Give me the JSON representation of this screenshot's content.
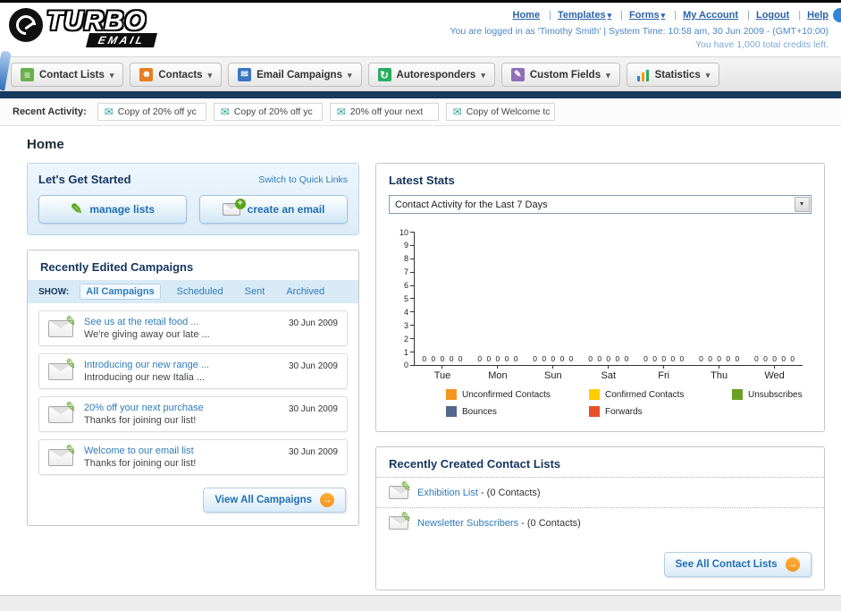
{
  "header": {
    "logo": {
      "title": "TURBO",
      "subtitle": "EMAIL"
    },
    "links": [
      {
        "label": "Home",
        "menu": false
      },
      {
        "label": "Templates",
        "menu": true
      },
      {
        "label": "Forms",
        "menu": true
      },
      {
        "label": "My Account",
        "menu": false
      },
      {
        "label": "Logout",
        "menu": false
      },
      {
        "label": "Help",
        "menu": false
      }
    ],
    "login_info": "You are logged in as 'Timothy Smith' | System Time: 10:58 am, 30 Jun 2009 - (GMT+10:00)",
    "credits_info": "You have 1,000 total credits left."
  },
  "nav": {
    "items": [
      {
        "label": "Contact Lists"
      },
      {
        "label": "Contacts"
      },
      {
        "label": "Email Campaigns"
      },
      {
        "label": "Autoresponders"
      },
      {
        "label": "Custom Fields"
      },
      {
        "label": "Statistics"
      }
    ]
  },
  "recent_activity": {
    "label": "Recent Activity:",
    "items": [
      "Copy of 20% off yc",
      "Copy of 20% off yc",
      "20% off your next",
      "Copy of Welcome tc"
    ]
  },
  "page_title": "Home",
  "get_started": {
    "title": "Let's Get Started",
    "switch_link": "Switch to Quick Links",
    "buttons": [
      {
        "label": "manage lists"
      },
      {
        "label": "create an email"
      }
    ]
  },
  "campaigns": {
    "title": "Recently Edited Campaigns",
    "show_label": "SHOW:",
    "tabs": [
      "All Campaigns",
      "Scheduled",
      "Sent",
      "Archived"
    ],
    "items": [
      {
        "title": "See us at the retail food ...",
        "subtitle": "We're giving away our late ...",
        "date": "30 Jun 2009"
      },
      {
        "title": "Introducing our new range ...",
        "subtitle": "Introducing our new Italia ...",
        "date": "30 Jun 2009"
      },
      {
        "title": "20% off your next purchase",
        "subtitle": "Thanks for joining our list!",
        "date": "30 Jun 2009"
      },
      {
        "title": "Welcome to our email list",
        "subtitle": "Thanks for joining our list!",
        "date": "30 Jun 2009"
      }
    ],
    "view_all_label": "View All Campaigns"
  },
  "latest_stats": {
    "title": "Latest Stats",
    "dropdown_value": "Contact Activity for the Last 7 Days",
    "chart_data": {
      "type": "bar",
      "title": "Contact Activity for the Last 7 Days",
      "categories": [
        "Tue",
        "Mon",
        "Sun",
        "Sat",
        "Fri",
        "Thu",
        "Wed"
      ],
      "series": [
        {
          "name": "Unconfirmed Contacts",
          "color": "#f7941d",
          "values": [
            0,
            0,
            0,
            0,
            0,
            0,
            0
          ]
        },
        {
          "name": "Confirmed Contacts",
          "color": "#ffcc00",
          "values": [
            0,
            0,
            0,
            0,
            0,
            0,
            0
          ]
        },
        {
          "name": "Unsubscribes",
          "color": "#6aa121",
          "values": [
            0,
            0,
            0,
            0,
            0,
            0,
            0
          ]
        },
        {
          "name": "Bounces",
          "color": "#51678f",
          "values": [
            0,
            0,
            0,
            0,
            0,
            0,
            0
          ]
        },
        {
          "name": "Forwards",
          "color": "#e8502a",
          "values": [
            0,
            0,
            0,
            0,
            0,
            0,
            0
          ]
        }
      ],
      "ylim": [
        0,
        10
      ],
      "xlabel": "",
      "ylabel": "",
      "grid": false,
      "legend_position": "bottom",
      "bar_value_labels": true
    }
  },
  "contact_lists": {
    "title": "Recently Created Contact Lists",
    "items": [
      {
        "name": "Exhibition List",
        "suffix": "- (0 Contacts)"
      },
      {
        "name": "Newsletter Subscribers",
        "suffix": "- (0 Contacts)"
      }
    ],
    "see_all_label": "See All Contact Lists"
  }
}
